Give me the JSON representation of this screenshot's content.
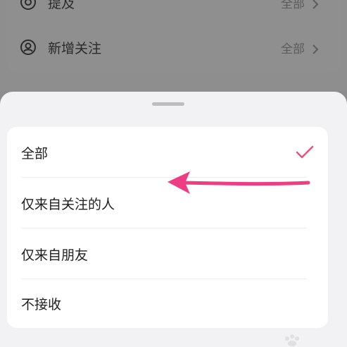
{
  "background_list": {
    "rows": [
      {
        "label": "提及",
        "value": "全部",
        "icon": "at-icon"
      },
      {
        "label": "新增关注",
        "value": "全部",
        "icon": "user-circle-icon"
      }
    ]
  },
  "sheet": {
    "options": [
      {
        "label": "全部",
        "selected": true
      },
      {
        "label": "仅来自关注的人",
        "selected": false
      },
      {
        "label": "仅来自朋友",
        "selected": false
      },
      {
        "label": "不接收",
        "selected": false
      }
    ]
  },
  "colors": {
    "check": "#e8547a",
    "arrow": "#ef3d84",
    "sheet_bg": "#f2f2f4",
    "card_bg": "#ffffff"
  }
}
